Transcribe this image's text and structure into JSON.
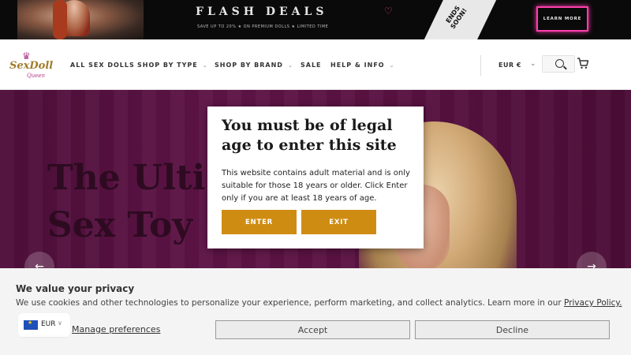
{
  "promo": {
    "title": "FLASH DEALS",
    "subtitle": "SAVE UP TO 20% ★ ON PREMIUM DOLLS ★ LIMITED TIME",
    "ends_soon": "ENDS\nSOON!",
    "learn_more": "LEARN MORE"
  },
  "header": {
    "logo_text": "SexDoll",
    "logo_sub": "Queen",
    "nav": [
      "ALL SEX DOLLS",
      "SHOP BY TYPE",
      "SHOP BY BRAND",
      "SALE",
      "HELP & INFO"
    ],
    "currency": "EUR €"
  },
  "hero": {
    "title": "The Ulti\nSex Toy",
    "prev_arrow": "←",
    "next_arrow": "→"
  },
  "age_modal": {
    "title": "You must be of legal age to enter this site",
    "body": "This website contains adult material and is only suitable for those 18 years or older. Click Enter only if you are at least 18 years of age.",
    "enter_label": "ENTER",
    "exit_label": "EXIT"
  },
  "privacy": {
    "title": "We value your privacy",
    "text": "We use cookies and other technologies to personalize your experience, perform marketing, and collect analytics. Learn more in our ",
    "link": "Privacy Policy.",
    "manage": "Manage preferences",
    "accept": "Accept",
    "decline": "Decline"
  },
  "currency_picker": {
    "label": "EUR"
  },
  "colors": {
    "accent_gold": "#cf8c13",
    "hero_purple": "#5e1446",
    "neon_pink": "#ff3fae"
  }
}
